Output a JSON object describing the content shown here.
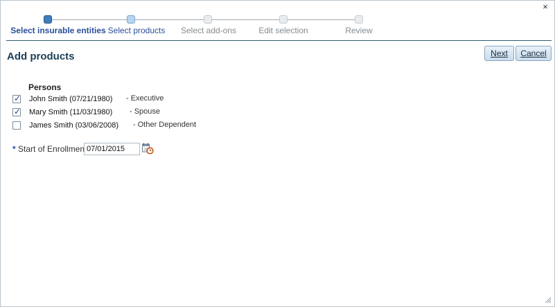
{
  "window": {
    "close_glyph": "×"
  },
  "train": {
    "steps": [
      {
        "label": "Select insurable entities",
        "state": "visited"
      },
      {
        "label": "Select products",
        "state": "current"
      },
      {
        "label": "Select add-ons",
        "state": "unvisited"
      },
      {
        "label": "Edit selection",
        "state": "unvisited"
      },
      {
        "label": "Review",
        "state": "unvisited"
      }
    ]
  },
  "page": {
    "title": "Add products"
  },
  "actions": {
    "next_label": "Next",
    "cancel_label": "Cancel"
  },
  "persons": {
    "heading": "Persons",
    "items": [
      {
        "name": "John Smith (07/21/1980)",
        "role": "- Executive",
        "checked": true
      },
      {
        "name": "Mary Smith (11/03/1980)",
        "role": "- Spouse",
        "checked": true
      },
      {
        "name": "James Smith (03/06/2008)",
        "role": "- Other Dependent",
        "checked": false
      }
    ]
  },
  "enrollment": {
    "required_marker": "*",
    "label": "Start of Enrollment",
    "value": "07/01/2015"
  },
  "colors": {
    "accent": "#2a4f9a",
    "title": "#1c3f55",
    "rule": "#2f5f6e"
  },
  "icons": {
    "calendar": "calendar-icon",
    "close": "close-icon",
    "resize": "resize-grip-icon"
  }
}
